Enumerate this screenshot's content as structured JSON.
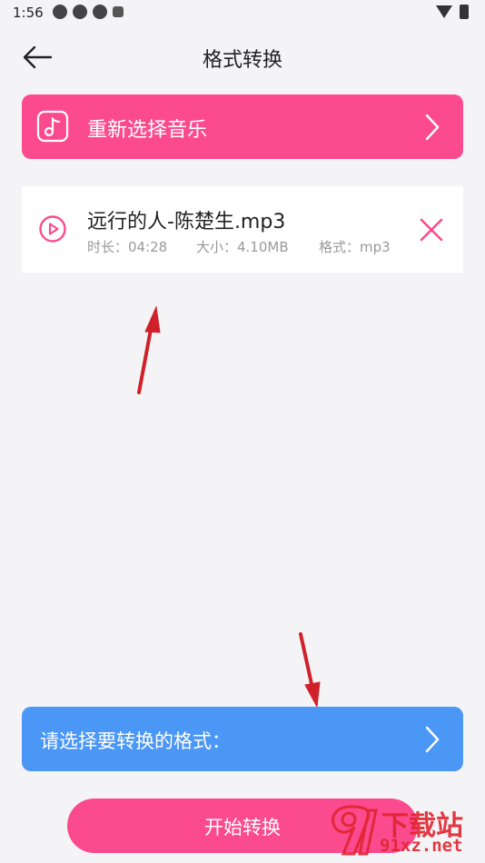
{
  "status_bar": {
    "time": "1:56"
  },
  "header": {
    "title": "格式转换"
  },
  "reselect": {
    "label": "重新选择音乐"
  },
  "file": {
    "name": "远行的人-陈楚生.mp3",
    "duration": "时长：04:28",
    "size": "大小：4.10MB",
    "format": "格式：mp3"
  },
  "format_select": {
    "label": "请选择要转换的格式："
  },
  "start": {
    "label": "开始转换"
  },
  "watermark": {
    "text": "下载站",
    "url": "91xz.net"
  },
  "colors": {
    "accent_pink": "#fb4b8e",
    "accent_blue": "#4b97f6",
    "annotation_red": "#d0202a"
  }
}
